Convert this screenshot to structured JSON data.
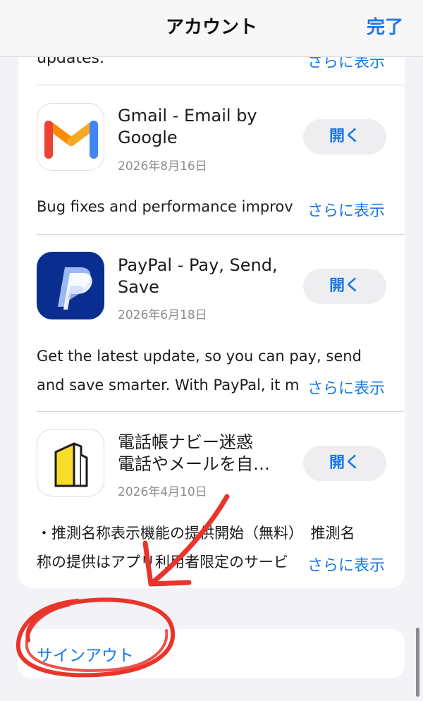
{
  "navbar": {
    "title": "アカウント",
    "done_label": "完了"
  },
  "clipped_item": {
    "text": "updates.",
    "more_label": "さらに表示"
  },
  "apps": [
    {
      "name_line1": "Gmail - Email by",
      "name_line2": "Google",
      "date": "2026年8月16日",
      "open_label": "開く",
      "desc_line1": "Bug fixes and performance improv",
      "desc_line2": "",
      "more_label": "さらに表示",
      "icon": "gmail-icon"
    },
    {
      "name_line1": "PayPal - Pay, Send,",
      "name_line2": "Save",
      "date": "2026年6月18日",
      "open_label": "開く",
      "desc_line1": "Get the latest update, so you can pay, send",
      "desc_line2": "and save smarter. With PayPal, it m",
      "more_label": "さらに表示",
      "icon": "paypal-icon"
    },
    {
      "name_line1": "電話帳ナビー迷惑",
      "name_line2": "電話やメールを自…",
      "date": "2026年4月10日",
      "open_label": "開く",
      "desc_line1": "・推測名称表示機能の提供開始（無料）　推測名",
      "desc_line2": "称の提供はアプリ利用者限定のサービ",
      "more_label": "さらに表示",
      "icon": "denwacho-navi-icon"
    }
  ],
  "signout": {
    "label": "サインアウト"
  },
  "colors": {
    "accent": "#1a78e6",
    "annotation": "#e8352b",
    "background": "#f2f2f7"
  }
}
